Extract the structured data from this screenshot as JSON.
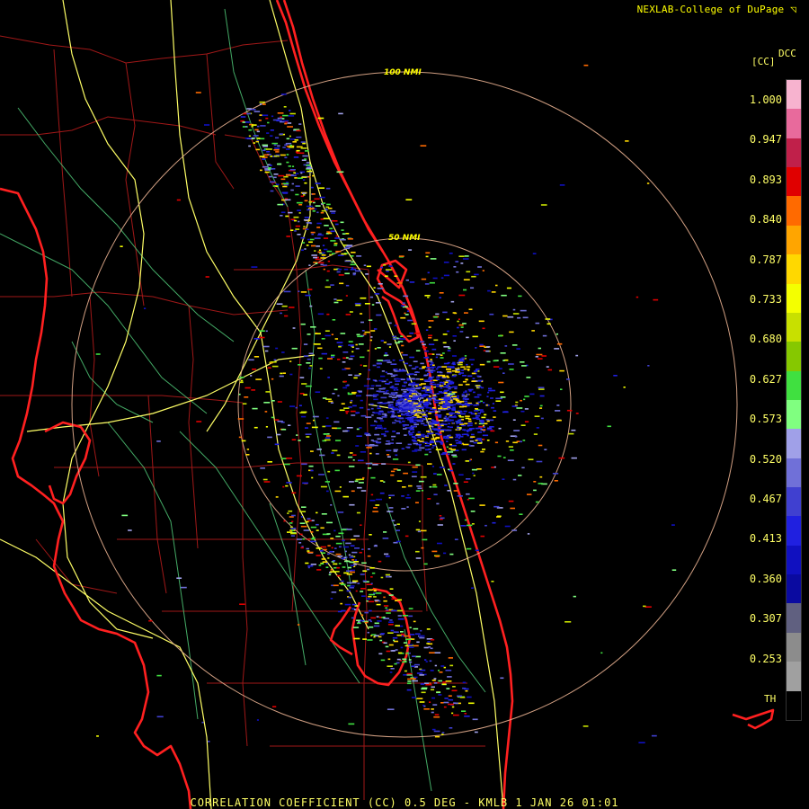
{
  "header": {
    "credit": "NEXLAB-College of DuPage"
  },
  "caption": "CORRELATION COEFFICIENT (CC) 0.5 DEG - KMLB 1 JAN 26 01:01",
  "legend": {
    "product_code": "DCC",
    "units": "[CC]",
    "ticks": [
      "1.000",
      "0.947",
      "0.893",
      "0.840",
      "0.787",
      "0.733",
      "0.680",
      "0.627",
      "0.573",
      "0.520",
      "0.467",
      "0.413",
      "0.360",
      "0.307",
      "0.253"
    ],
    "threshold_label": "TH",
    "colors": [
      "#f7b3cf",
      "#e86a9c",
      "#c0204a",
      "#e00000",
      "#ff6a00",
      "#ffa500",
      "#ffd800",
      "#f4ff00",
      "#c8e000",
      "#86c800",
      "#40e040",
      "#80ff80",
      "#a0a0e8",
      "#7070d8",
      "#4040d0",
      "#2020e0",
      "#1010c0",
      "#0a0aa0",
      "#606080",
      "#8c8c8c",
      "#a0a0a0",
      "#000000"
    ]
  },
  "range_rings": [
    {
      "label": "100 NMI"
    },
    {
      "label": "50 NMI"
    }
  ],
  "colors": {
    "background": "#000000",
    "county_borders": "#a01818",
    "highways": "#ffff66",
    "rivers_roads": "#50c878",
    "coastline": "#ff2020",
    "range_ring": "#e8b090"
  },
  "icons": {
    "logo": "nexlab-logo-icon"
  }
}
